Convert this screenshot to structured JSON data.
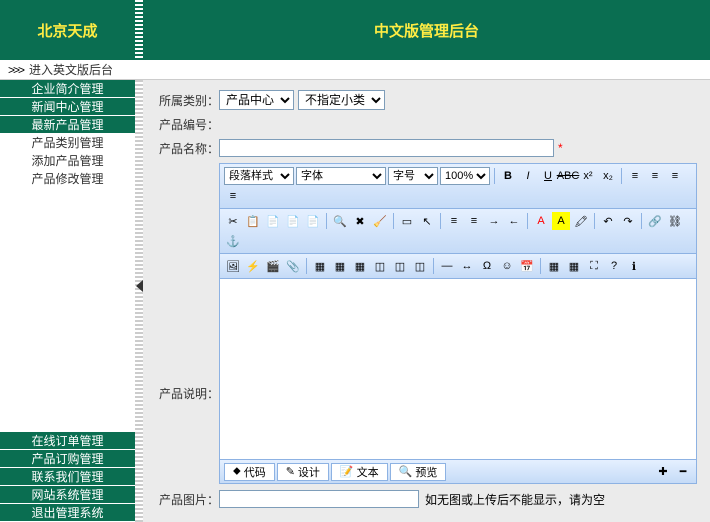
{
  "header": {
    "left_title": "北京天成",
    "right_title": "中文版管理后台"
  },
  "subheader": {
    "arrow": ">>>",
    "link": "进入英文版后台"
  },
  "sidebar": {
    "top_menu": [
      {
        "label": "企业简介管理",
        "style": "dark"
      },
      {
        "label": "新闻中心管理",
        "style": "dark"
      },
      {
        "label": "最新产品管理",
        "style": "dark"
      },
      {
        "label": "产品类别管理",
        "style": "light"
      },
      {
        "label": "添加产品管理",
        "style": "light"
      },
      {
        "label": "产品修改管理",
        "style": "light"
      }
    ],
    "bottom_menu": [
      {
        "label": "在线订单管理",
        "style": "dark"
      },
      {
        "label": "产品订购管理",
        "style": "dark"
      },
      {
        "label": "联系我们管理",
        "style": "dark"
      },
      {
        "label": "网站系统管理",
        "style": "dark"
      },
      {
        "label": "退出管理系统",
        "style": "dark"
      }
    ]
  },
  "form": {
    "category_label": "所属类别：",
    "category_sel_1": "产品中心",
    "category_sel_2": "不指定小类",
    "product_no_label": "产品编号：",
    "product_name_label": "产品名称：",
    "product_desc_label": "产品说明：",
    "product_img_label": "产品图片：",
    "img_hint": "如无图或上传后不能显示，请为空"
  },
  "editor": {
    "para_style": "段落样式",
    "font": "字体",
    "size": "字号",
    "zoom": "100%",
    "tabs": {
      "code": "代码",
      "design": "设计",
      "text": "文本",
      "preview": "预览"
    }
  }
}
